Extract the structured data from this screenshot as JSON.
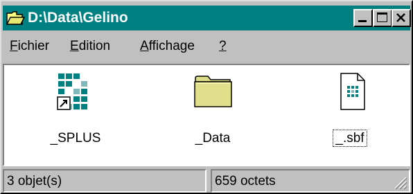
{
  "window": {
    "title": "D:\\Data\\Gelino"
  },
  "menu": [
    {
      "accel": "F",
      "rest": "ichier"
    },
    {
      "accel": "E",
      "rest": "dition"
    },
    {
      "accel": "A",
      "rest": "ffichage"
    },
    {
      "accel": "?",
      "rest": ""
    }
  ],
  "items": [
    {
      "label": "_SPLUS",
      "icon": "shortcut-icon"
    },
    {
      "label": "_Data",
      "icon": "folder-icon"
    },
    {
      "label": "_.sbf",
      "icon": "document-icon"
    }
  ],
  "status": {
    "objects": "3 objet(s)",
    "size": "659 octets"
  },
  "colors": {
    "titlebar": "#008080",
    "folder": "#dcdc86",
    "pattern": "#008080"
  }
}
